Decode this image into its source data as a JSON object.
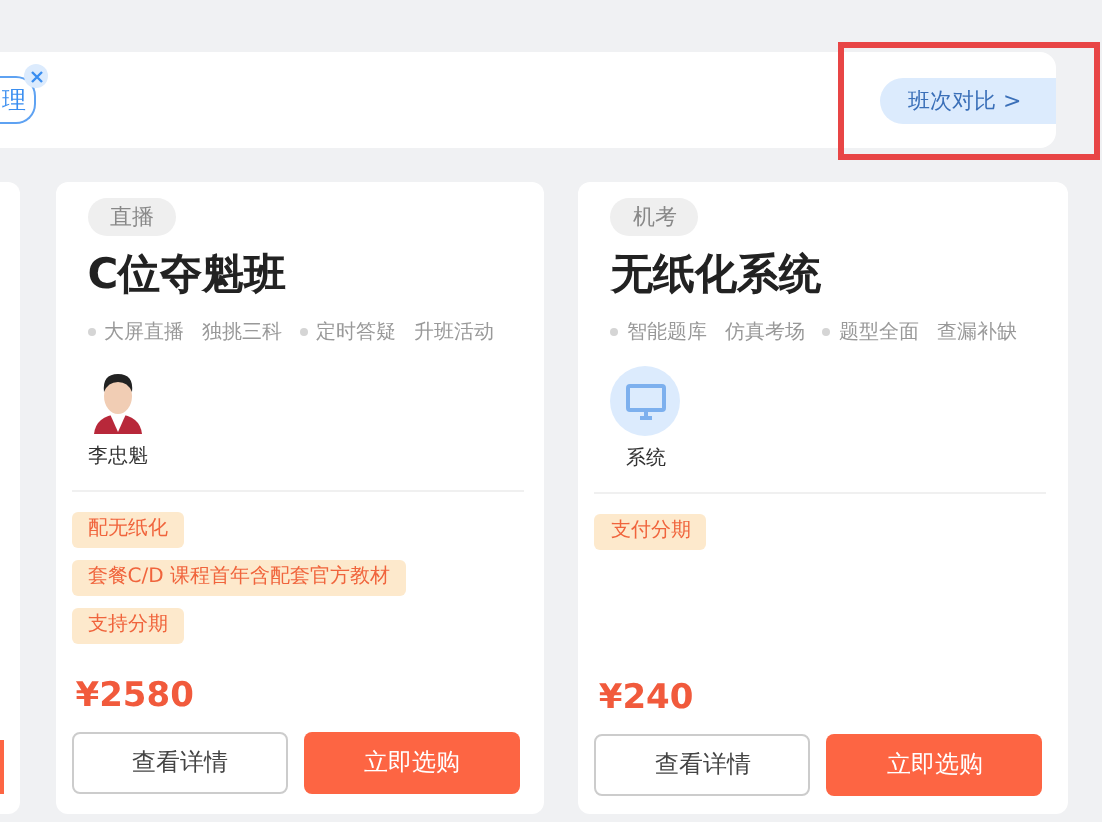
{
  "filter_bar": {
    "chips": [
      {
        "label": "理",
        "removable": true
      }
    ],
    "compare_button": {
      "label": "班次对比 >",
      "highlighted": true
    }
  },
  "cards": [
    {
      "tag": "直播",
      "title": "C位夺魁班",
      "features": [
        {
          "text": "大屏直播",
          "dot": true
        },
        {
          "text": "独挑三科",
          "dot": false
        },
        {
          "text": "定时答疑",
          "dot": true
        },
        {
          "text": "升班活动",
          "dot": false
        }
      ],
      "provider": {
        "kind": "person",
        "name": "李忠魁"
      },
      "promos": [
        "配无纸化",
        "套餐C/D 课程首年含配套官方教材",
        "支持分期"
      ],
      "price": "¥2580",
      "buttons": [
        {
          "label": "查看详情",
          "kind": "outline"
        },
        {
          "label": "立即选购",
          "kind": "primary"
        }
      ]
    },
    {
      "tag": "机考",
      "title": "无纸化系统",
      "features": [
        {
          "text": "智能题库",
          "dot": true
        },
        {
          "text": "仿真考场",
          "dot": false
        },
        {
          "text": "题型全面",
          "dot": true
        },
        {
          "text": "查漏补缺",
          "dot": false
        }
      ],
      "provider": {
        "kind": "system",
        "name": "系统"
      },
      "promos": [
        "支付分期"
      ],
      "price": "¥240",
      "buttons": [
        {
          "label": "查看详情",
          "kind": "outline"
        },
        {
          "label": "立即选购",
          "kind": "primary"
        }
      ]
    }
  ]
}
